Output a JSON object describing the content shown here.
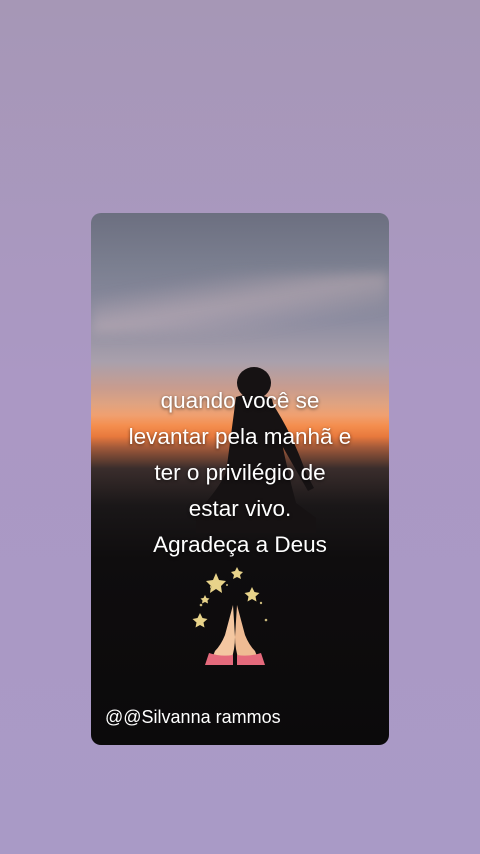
{
  "card": {
    "quote_lines": [
      "quando você se",
      "levantar pela manhã e",
      "ter o privilégio de",
      "estar vivo.",
      "Agradeça a Deus"
    ],
    "emoji": "praying-hands-with-stars",
    "author": "@@Silvanna rammos"
  },
  "colors": {
    "background": "#ab98c4",
    "text": "#ffffff",
    "sunset": "#f48e4e"
  }
}
